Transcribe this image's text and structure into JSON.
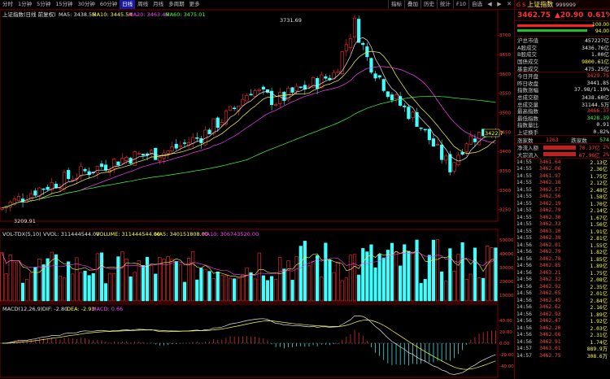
{
  "toolbar": {
    "tabs": [
      "分时",
      "1分钟",
      "5分钟",
      "15分钟",
      "30分钟",
      "60分钟",
      "日线",
      "周线",
      "月线",
      "多周期",
      "更多"
    ],
    "active_index": 6,
    "right": [
      "指标",
      "叠加",
      "历史",
      "统计",
      "F10",
      "自选"
    ]
  },
  "main": {
    "title": "上证指数(日线 前复权)",
    "ma5": "MA5: 3438.55",
    "ma10": "MA10: 3445.54",
    "ma20": "MA20: 3463.46",
    "ma60": "MA60: 3475.01",
    "high_label": "3731.69",
    "low_label": "3209.91",
    "price_tag": "3422.7",
    "yaxis": [
      "3700",
      "3650",
      "3600",
      "3550",
      "3500",
      "3450",
      "3400",
      "3350",
      "3300",
      "3250"
    ]
  },
  "volume": {
    "title": "VOL-TDX(5,10)",
    "vvol": "VVOL: 311444544.00",
    "vol": "VOLUME: 311444544.00",
    "ma5": "MA5: 340151808.00",
    "ma10": "MA10: 306743520.00",
    "yaxis": [
      "50000",
      "40000",
      "30000",
      "20000",
      "10000"
    ]
  },
  "macd": {
    "title": "MACD(12,26,9)",
    "dif": "DIF: -2.80",
    "dea": "DEA: -2.93",
    "macd": "MACD: 0.66",
    "yaxis": [
      "40.00",
      "20.00",
      "0.00",
      "-20.00",
      "-40.00"
    ]
  },
  "chart_data": [
    {
      "type": "candlestick",
      "title": "上证指数(日线 前复权)",
      "y_high": 3731.69,
      "y_low": 3209.91,
      "last": 3422.7,
      "ylim": [
        3220,
        3740
      ]
    },
    {
      "type": "bar",
      "title": "VOL-TDX(5,10)",
      "last": 311444544
    },
    {
      "type": "bar",
      "title": "MACD(12,26,9)",
      "dif": -2.8,
      "dea": -2.93,
      "macd": 0.66
    }
  ],
  "quote": {
    "gs": "G S",
    "name": "上证指数",
    "code": "999999",
    "price": "3462.75",
    "change": "▲20.90",
    "pct": "0.61%",
    "bar1": "100.00",
    "bar2": "94.00"
  },
  "stats": [
    {
      "label": "沪总市值",
      "value": "457227亿",
      "color": "white"
    },
    {
      "label": "A股成交",
      "value": "3436.76亿",
      "color": "white"
    },
    {
      "label": "B股成交",
      "value": "1.00亿",
      "color": "white"
    },
    {
      "label": "国债成交",
      "value": "9800.61亿",
      "color": "yellow"
    },
    {
      "label": "基金成交",
      "value": "475.25亿",
      "color": "white"
    },
    {
      "label": "今日开盘",
      "value": "3429.75",
      "color": "red"
    },
    {
      "label": "昨日收盘",
      "value": "3441.85",
      "color": "white"
    },
    {
      "label": "指数涨幅",
      "value": "37.98/1.10%",
      "color": "white"
    },
    {
      "label": "总成交额",
      "value": "3438.60亿",
      "color": "white"
    },
    {
      "label": "总成交量",
      "value": "31144.5万",
      "color": "white"
    },
    {
      "label": "最高指数",
      "value": "3466.37",
      "color": "red"
    },
    {
      "label": "最低指数",
      "value": "3428.39",
      "color": "green"
    },
    {
      "label": "指数量比",
      "value": "0.91",
      "color": "white"
    },
    {
      "label": "上证换手",
      "value": "0.82%",
      "color": "white"
    }
  ],
  "updown": {
    "label": "涨家数",
    "up": "1263",
    "down_label": "跌家数",
    "down": "574"
  },
  "flows": [
    {
      "label": "净流入额",
      "value": "70.37亿",
      "pct": "2%"
    },
    {
      "label": "大宗流入",
      "value": "67.96亿",
      "pct": "2%"
    }
  ],
  "trades": [
    [
      "14:55",
      "3461.64",
      "2.13亿"
    ],
    [
      "14:55",
      "3462.06",
      "2.36亿"
    ],
    [
      "14:55",
      "3461.97",
      "1.75亿"
    ],
    [
      "14:55",
      "3462.18",
      "2.12亿"
    ],
    [
      "14:55",
      "3462.57",
      "2.48亿"
    ],
    [
      "14:55",
      "3462.56",
      "1.58亿"
    ],
    [
      "14:55",
      "3462.19",
      "1.70亿"
    ],
    [
      "14:55",
      "3462.79",
      "2.14亿"
    ],
    [
      "14:55",
      "3462.30",
      "1.67亿"
    ],
    [
      "14:55",
      "3462.33",
      "1.56亿"
    ],
    [
      "14:55",
      "3463.10",
      "1.91亿"
    ],
    [
      "14:55",
      "3462.38",
      "2.81亿"
    ],
    [
      "14:56",
      "3462.81",
      "1.55亿"
    ],
    [
      "14:56",
      "3462.79",
      "1.82亿"
    ],
    [
      "14:56",
      "3462.78",
      "1.85亿"
    ],
    [
      "14:56",
      "3462.85",
      "1.89亿"
    ],
    [
      "14:56",
      "3463.21",
      "1.75亿"
    ],
    [
      "14:56",
      "3462.32",
      "2.08亿"
    ],
    [
      "14:56",
      "3462.92",
      "2.35亿"
    ],
    [
      "14:56",
      "3462.65",
      "2.01亿"
    ],
    [
      "14:56",
      "3462.45",
      "2.84亿"
    ],
    [
      "14:56",
      "3462.62",
      "2.16亿"
    ],
    [
      "14:56",
      "3462.93",
      "1.89亿"
    ],
    [
      "14:56",
      "3462.47",
      "1.92亿"
    ],
    [
      "14:56",
      "3462.20",
      "2.03亿"
    ],
    [
      "14:56",
      "3462.66",
      "2.31亿"
    ],
    [
      "14:56",
      "3462.91",
      "1.74亿"
    ],
    [
      "14:57",
      "3463.01",
      "889.9万"
    ],
    [
      "14:57",
      "3462.75",
      "308.6万"
    ]
  ]
}
